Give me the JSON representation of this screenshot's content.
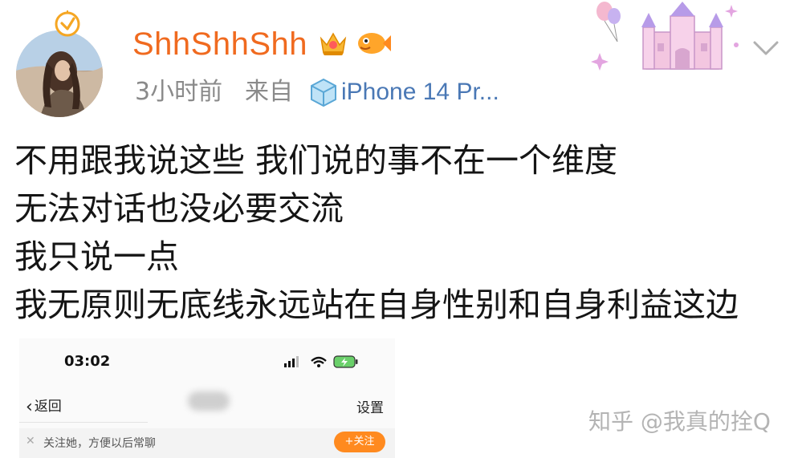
{
  "header": {
    "username": "ShhShhShh",
    "time": "3小时前",
    "source_prefix": "来自",
    "device": "iPhone 14 Pr..."
  },
  "post": {
    "lines": [
      "不用跟我说这些 我们说的事不在一个维度",
      "无法对话也没必要交流",
      "我只说一点",
      "我无原则无底线永远站在自身性别和自身利益这边"
    ]
  },
  "screenshot": {
    "status_time": "03:02",
    "back_label": "返回",
    "settings_label": "设置",
    "follow_hint": "关注她，方便以后常聊",
    "follow_button": "+关注"
  },
  "watermark": "知乎 @我真的拴Q",
  "colors": {
    "username": "#f06a1f",
    "meta": "#8a8a8a",
    "device": "#4a78b5",
    "follow_button": "#ff8a1f"
  }
}
